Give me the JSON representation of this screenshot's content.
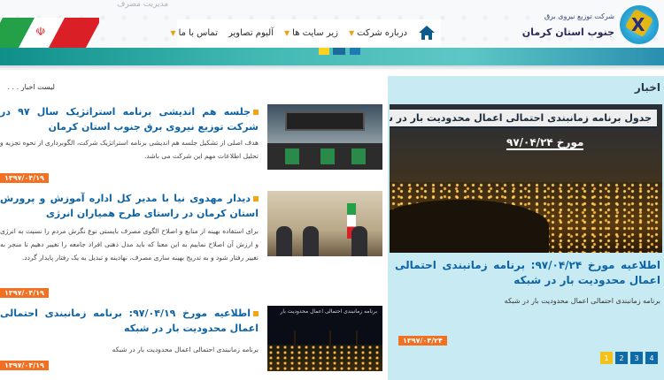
{
  "header": {
    "company_small": "شرکت توزیع نیروی برق",
    "company_name": "جنوب استان کرمان",
    "ghost_text": "مدیریت مصرف",
    "nav": [
      {
        "label": "درباره شرکت"
      },
      {
        "label": "زیر سایت ها"
      },
      {
        "label": "آلبوم تصاویر"
      },
      {
        "label": "تماس با ما"
      }
    ],
    "flag_emblem": "☫"
  },
  "right_panel": {
    "title": "اخبار",
    "feature_banner": "جدول برنامه زمانبندی احتمالی اعمال محدودیت بار در شبکه",
    "feature_date": "مورخ ۹۷/۰۴/۲۴",
    "headline": "اطلاعیه مورخ ۹۷/۰۴/۲۴: برنامه زمانبندی احتمالی اعمال محدودیت بار در شبکه",
    "subtext": "برنامه زمانبندی احتمالی اعمال محدودیت بار در شبکه",
    "date": "۱۳۹۷/۰۴/۲۴",
    "pages": [
      "1",
      "2",
      "3",
      "4"
    ]
  },
  "news_list": {
    "title": "لیست اخبار . . .",
    "items": [
      {
        "title": "جلسه هم اندیشی برنامه استراتژیک سال ۹۷ در شرکت توزیع نیروی برق جنوب استان کرمان",
        "body": "هدف اصلی از تشکیل جلسه هم اندیشی برنامه استراتژیک شرکت، الگوبرداری از نحوه تجزیه و تحلیل اطلاعات مهم این شرکت می باشد.",
        "date": "۱۳۹۷/۰۴/۱۹"
      },
      {
        "title": "دیدار مهدوی نیا با مدیر کل اداره آموزش و پرورش استان کرمان در راستای طرح همیاران انرژی",
        "body": "برای استفاده بهینه از منابع و اصلاح الگوی مصرف بایستی نوع نگرش مردم را نسبت به انرژی و ارزش آن اصلاح نماییم به این معنا که باید مدل ذهنی افراد جامعه را تغییر دهیم تا منجر به تغییر رفتار شود و به تدریج بهینه سازی مصرف، نهادینه و تبدیل به یک رفتار پایدار گردد.",
        "date": "۱۳۹۷/۰۴/۱۹"
      },
      {
        "title": "اطلاعیه مورخ ۹۷/۰۴/۱۹: برنامه زمانبندی احتمالی اعمال محدودیت بار در شبکه",
        "body": "برنامه زمانبندی احتمالی اعمال محدودیت بار در شبکه",
        "date": "۱۳۹۷/۰۴/۱۹",
        "thumb_caption": "برنامه زمانبندی احتمالی اعمال محدودیت بار"
      }
    ]
  },
  "colors": {
    "accent_blue": "#0e63a4",
    "accent_orange": "#f36f21",
    "panel_bg": "#c8ebf3",
    "teal": "#43b9b4"
  }
}
